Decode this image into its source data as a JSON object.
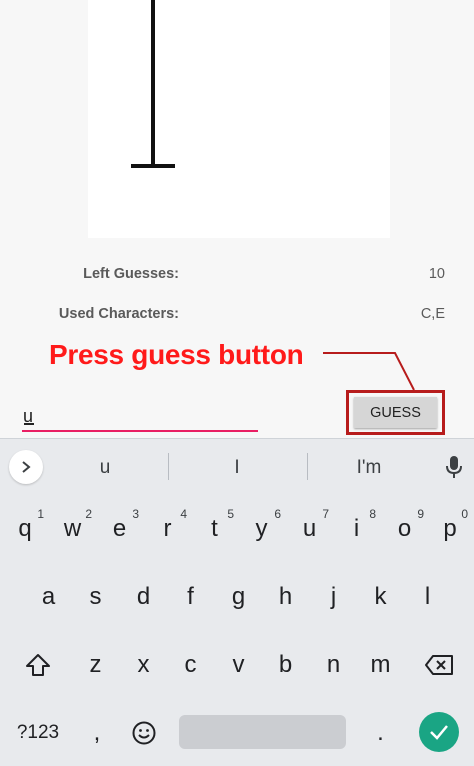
{
  "game": {
    "left_guesses_label": "Left Guesses:",
    "left_guesses_value": "10",
    "used_chars_label": "Used Characters:",
    "used_chars_value": "C,E"
  },
  "annotation": {
    "text": "Press guess button",
    "color": "#ff1a1a",
    "box_color": "#b71c1c"
  },
  "input": {
    "value": "u",
    "underline_color": "#e91e63"
  },
  "guess_button": {
    "label": "GUESS"
  },
  "keyboard": {
    "suggestions": [
      "u",
      "I",
      "I'm"
    ],
    "row1": [
      {
        "key": "q",
        "hint": "1"
      },
      {
        "key": "w",
        "hint": "2"
      },
      {
        "key": "e",
        "hint": "3"
      },
      {
        "key": "r",
        "hint": "4"
      },
      {
        "key": "t",
        "hint": "5"
      },
      {
        "key": "y",
        "hint": "6"
      },
      {
        "key": "u",
        "hint": "7"
      },
      {
        "key": "i",
        "hint": "8"
      },
      {
        "key": "o",
        "hint": "9"
      },
      {
        "key": "p",
        "hint": "0"
      }
    ],
    "row2": [
      "a",
      "s",
      "d",
      "f",
      "g",
      "h",
      "j",
      "k",
      "l"
    ],
    "row3": [
      "z",
      "x",
      "c",
      "v",
      "b",
      "n",
      "m"
    ],
    "symbols_label": "?123",
    "comma": ",",
    "period": ".",
    "accent_color": "#1aa584",
    "icons": [
      "chevron-right-icon",
      "mic-icon",
      "shift-icon",
      "backspace-icon",
      "emoji-icon",
      "check-icon"
    ]
  }
}
